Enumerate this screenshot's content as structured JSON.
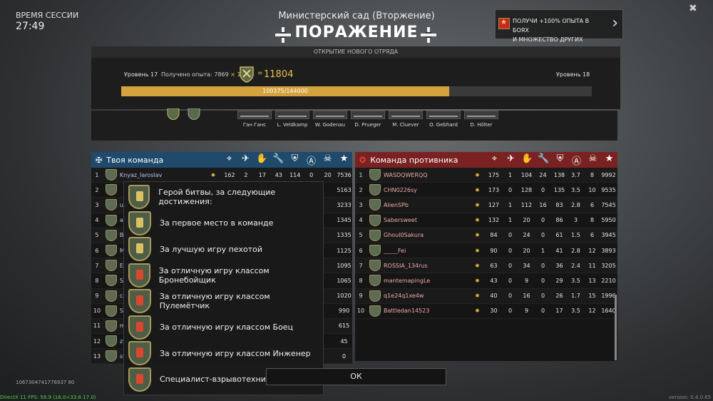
{
  "session": {
    "label": "ВРЕМЯ СЕССИИ",
    "time": "27:49"
  },
  "map_title": "Министерский сад (Вторжение)",
  "result": "ПОРАЖЕНИЕ",
  "promo": {
    "line1": "ПОЛУЧИ +100% ОПЫТА В БОЯХ",
    "line2": "И МНОЖЕСТВО ДРУГИХ БОНУСОВ"
  },
  "squad_header": "ОТКРЫТИЕ НОВОГО ОТРЯДА",
  "progress": {
    "level_current": "Уровень 17",
    "got_label": "Получено опыта:",
    "got_value": "7869",
    "multiplier": "× 1.5",
    "equals": "=",
    "total": "11804",
    "level_next": "Уровень 18",
    "bar_text": "100375/144000",
    "fraction": 0.697
  },
  "squad": [
    {
      "name": "Ган Ганс"
    },
    {
      "name": "L. Veldkamp"
    },
    {
      "name": "W. Godenau"
    },
    {
      "name": "D. Prueger"
    },
    {
      "name": "M. Cluever"
    },
    {
      "name": "O. Gebhard"
    },
    {
      "name": "D. Hölter"
    }
  ],
  "team_left": {
    "title": "Твоя команда",
    "rows": [
      {
        "n": "1",
        "name": "Knyaz_Iaroslav",
        "c": [
          "162",
          "2",
          "17",
          "43",
          "114",
          "0",
          "20",
          "7536"
        ]
      },
      {
        "n": "2",
        "name": "",
        "c": [
          "5163"
        ]
      },
      {
        "n": "3",
        "name": "uncle",
        "c": [
          "3233"
        ]
      },
      {
        "n": "4",
        "name": "alnoe",
        "c": [
          "1345"
        ]
      },
      {
        "n": "5",
        "name": "Ballin",
        "c": [
          "1335"
        ]
      },
      {
        "n": "6",
        "name": "Minge",
        "c": [
          "1125"
        ]
      },
      {
        "n": "7",
        "name": "Exxie",
        "c": [
          "1095"
        ]
      },
      {
        "n": "8",
        "name": "Shado",
        "c": [
          "1065"
        ]
      },
      {
        "n": "9",
        "name": "csgou",
        "c": [
          "1020"
        ]
      },
      {
        "n": "10",
        "name": "Sturk",
        "c": [
          "990"
        ]
      },
      {
        "n": "11",
        "name": "ma",
        "c": [
          "615"
        ]
      },
      {
        "n": "12",
        "name": "zbe",
        "c": [
          "45"
        ]
      },
      {
        "n": "13",
        "name": "ste",
        "c": [
          "0"
        ]
      }
    ]
  },
  "team_right": {
    "title": "Команда противника",
    "rows": [
      {
        "n": "1",
        "name": "WASDQWERQQ",
        "c": [
          "175",
          "1",
          "104",
          "24",
          "138",
          "3.7",
          "8",
          "9992"
        ]
      },
      {
        "n": "2",
        "name": "CHN0226sy",
        "c": [
          "173",
          "0",
          "128",
          "0",
          "135",
          "3.5",
          "10",
          "9535"
        ]
      },
      {
        "n": "3",
        "name": "AlienSPb",
        "c": [
          "127",
          "1",
          "112",
          "16",
          "83",
          "2.8",
          "6",
          "7545"
        ]
      },
      {
        "n": "4",
        "name": "Sabersweet",
        "c": [
          "132",
          "1",
          "20",
          "0",
          "86",
          "3",
          "8",
          "5950"
        ]
      },
      {
        "n": "5",
        "name": "Ghoul0Sakura",
        "c": [
          "84",
          "0",
          "24",
          "0",
          "61",
          "1.5",
          "6",
          "3945"
        ]
      },
      {
        "n": "6",
        "name": "_____Fei",
        "c": [
          "90",
          "0",
          "20",
          "1",
          "41",
          "2.8",
          "12",
          "3893"
        ]
      },
      {
        "n": "7",
        "name": "ROSSIA_134rus",
        "c": [
          "63",
          "0",
          "34",
          "0",
          "36",
          "2.4",
          "11",
          "3205"
        ]
      },
      {
        "n": "8",
        "name": "mantemapingLe",
        "c": [
          "43",
          "0",
          "9",
          "0",
          "29",
          "3.5",
          "13",
          "2210"
        ]
      },
      {
        "n": "9",
        "name": "q1e24q1xe4w",
        "c": [
          "40",
          "0",
          "16",
          "0",
          "26",
          "1.7",
          "15",
          "1996"
        ]
      },
      {
        "n": "10",
        "name": "Battledan14523",
        "c": [
          "30",
          "0",
          "9",
          "0",
          "17",
          "3.5",
          "12",
          "1640"
        ]
      }
    ]
  },
  "tooltip": [
    {
      "text": "Герой битвы, за следующие достижения:"
    },
    {
      "text": "За первое место в команде"
    },
    {
      "text": "За лучшую игру пехотой"
    },
    {
      "text": "За отличную игру классом Бронебойщик"
    },
    {
      "text": "За отличную игру классом Пулемётчик"
    },
    {
      "text": "За отличную игру классом Боец"
    },
    {
      "text": "За отличную игру классом Инженер"
    },
    {
      "text": "Специалист-взрывотехник"
    }
  ],
  "ok": "ОК",
  "id_text": "1067304741776937 80",
  "fps": "DirectX 11 FPS: 58.9 (16.0<33.6 17.0)",
  "version": "version: 0.4.0.65"
}
